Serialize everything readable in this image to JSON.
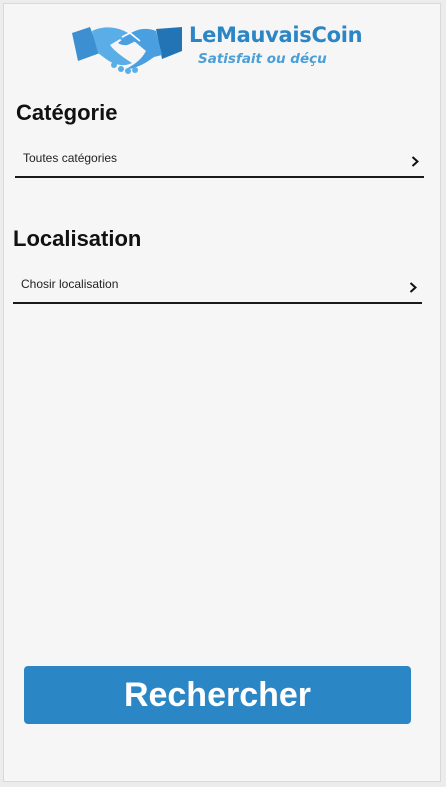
{
  "brand": {
    "name": "LeMauvaisCoin",
    "tagline": "Satisfait ou déçu",
    "logo_icon": "handshake-icon",
    "color": "#2b86c5"
  },
  "category": {
    "title": "Catégorie",
    "value": "Toutes catégories",
    "icon": "chevron-right-icon"
  },
  "location": {
    "title": "Localisation",
    "value": "Chosir localisation",
    "icon": "chevron-right-icon"
  },
  "search_button": {
    "label": "Rechercher",
    "color": "#2b86c5"
  }
}
